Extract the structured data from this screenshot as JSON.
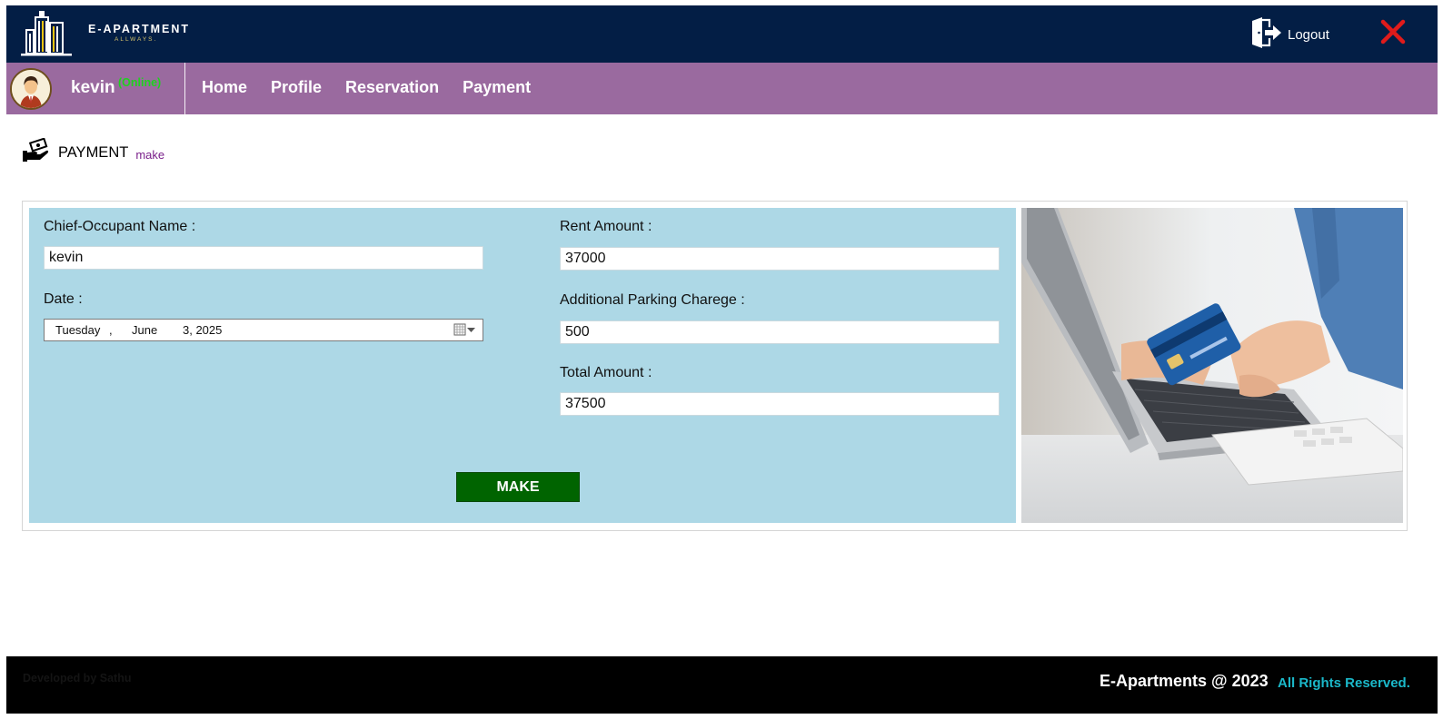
{
  "brand": {
    "name": "E-APARTMENT",
    "tagline": "ALLWAYS."
  },
  "header": {
    "logout_label": "Logout"
  },
  "user": {
    "name": "kevin",
    "status": "(Online)"
  },
  "nav": {
    "items": [
      {
        "label": "Home"
      },
      {
        "label": "Profile"
      },
      {
        "label": "Reservation"
      },
      {
        "label": "Payment"
      }
    ]
  },
  "page": {
    "title": "PAYMENT",
    "subtitle": "make"
  },
  "form": {
    "occupant_label": "Chief-Occupant Name :",
    "occupant_value": "kevin",
    "date_label": "Date :",
    "date": {
      "weekday": "Tuesday",
      "sep": ",",
      "month": "June",
      "day_year": "3, 2025"
    },
    "rent_label": "Rent Amount :",
    "rent_value": "37000",
    "parking_label": "Additional Parking Charege :",
    "parking_value": "500",
    "total_label": "Total Amount :",
    "total_value": "37500",
    "submit_label": "MAKE"
  },
  "footer": {
    "developer": "Developed by Sathu",
    "copyright": "E-Apartments @ 2023",
    "rights": "All Rights Reserved."
  },
  "colors": {
    "topbar": "#031e45",
    "navbar": "#9a6a9f",
    "form_bg": "#add8e6",
    "button": "#006400",
    "online": "#1fd11f",
    "close": "#e01b1b",
    "rights": "#1bb8c9"
  }
}
